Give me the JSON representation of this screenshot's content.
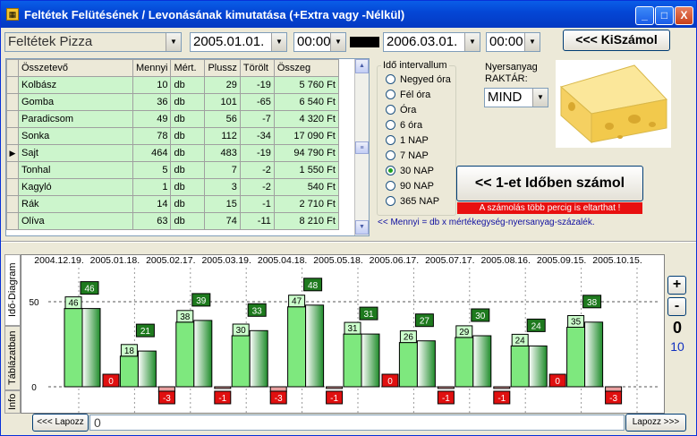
{
  "window": {
    "title": "Feltétek Felütésének / Levonásának kimutatása (+Extra vagy -Nélkül)",
    "controls": {
      "minimize": "_",
      "maximize": "□",
      "close": "X"
    }
  },
  "toolbar": {
    "product_value": "Feltétek Pizza",
    "date_from": "2005.01.01.",
    "time_from": "00:00",
    "date_to": "2006.03.01.",
    "time_to": "00:00",
    "calc_button": "<<< KiSzámol"
  },
  "grid": {
    "columns": [
      "Összetevő",
      "Mennyi",
      "Mért.",
      "Plussz",
      "Törölt",
      "Összeg"
    ],
    "rows": [
      [
        "Kolbász",
        "10",
        "db",
        "29",
        "-19",
        "5 760 Ft"
      ],
      [
        "Gomba",
        "36",
        "db",
        "101",
        "-65",
        "6 540 Ft"
      ],
      [
        "Paradicsom",
        "49",
        "db",
        "56",
        "-7",
        "4 320 Ft"
      ],
      [
        "Sonka",
        "78",
        "db",
        "112",
        "-34",
        "17 090 Ft"
      ],
      [
        "Sajt",
        "464",
        "db",
        "483",
        "-19",
        "94 790 Ft"
      ],
      [
        "Tonhal",
        "5",
        "db",
        "7",
        "-2",
        "1 550 Ft"
      ],
      [
        "Kagyló",
        "1",
        "db",
        "3",
        "-2",
        "540 Ft"
      ],
      [
        "Rák",
        "14",
        "db",
        "15",
        "-1",
        "2 710 Ft"
      ],
      [
        "Olíva",
        "63",
        "db",
        "74",
        "-11",
        "8 210 Ft"
      ]
    ],
    "current_row_marker": "▶"
  },
  "interval": {
    "legend": "Idő intervallum",
    "options": [
      "Negyed óra",
      "Fél óra",
      "Óra",
      "6 óra",
      "1 NAP",
      "7 NAP",
      "30 NAP",
      "90 NAP",
      "365 NAP"
    ],
    "selected": "30 NAP"
  },
  "stock": {
    "label_line1": "Nyersanyag",
    "label_line2": "RAKTÁR:",
    "value": "MIND"
  },
  "timecalc": {
    "button": "<< 1-et Időben számol",
    "warning": "A számolás több percig is eltarthat !"
  },
  "hint": "<< Mennyi = db x mértékegység-nyersanyag-százalék.",
  "side_tabs": [
    "Idő-Diagram",
    "Táblázatban",
    "Info"
  ],
  "chart_data": {
    "type": "bar",
    "categories": [
      "2004.12.19.",
      "2005.01.18.",
      "2005.02.17.",
      "2005.03.19.",
      "2005.04.18.",
      "2005.05.18.",
      "2005.06.17.",
      "2005.07.17.",
      "2005.08.16.",
      "2005.09.15."
    ],
    "top_labels": [
      "2004.12.19.",
      "2005.01.18.",
      "2005.02.17.",
      "2005.03.19.",
      "2005.04.18.",
      "2005.05.18.",
      "2005.06.17.",
      "2005.07.17.",
      "2005.08.16.",
      "2005.09.15.",
      "2005.10.15."
    ],
    "series": [
      {
        "values": [
          46,
          18,
          38,
          30,
          47,
          31,
          26,
          29,
          24,
          35
        ],
        "color": "#7ee87e"
      },
      {
        "values": [
          46,
          21,
          39,
          33,
          48,
          31,
          27,
          30,
          24,
          38
        ],
        "color": "#1e8c2a"
      },
      {
        "values": [
          0,
          -3,
          -1,
          -3,
          -1,
          0,
          -1,
          -1,
          0,
          -3
        ],
        "color": "#e02020"
      }
    ],
    "y_ticks": [
      0,
      50
    ],
    "ylim": [
      -5,
      70
    ],
    "grid": true
  },
  "chart_controls": {
    "zoom_in": "+",
    "zoom_out": "-",
    "count_value": "0",
    "scale_value": "10"
  },
  "footer": {
    "scroll_left": "<<< Lapozz",
    "scroll_right": "Lapozz >>>",
    "page_value": "0"
  }
}
